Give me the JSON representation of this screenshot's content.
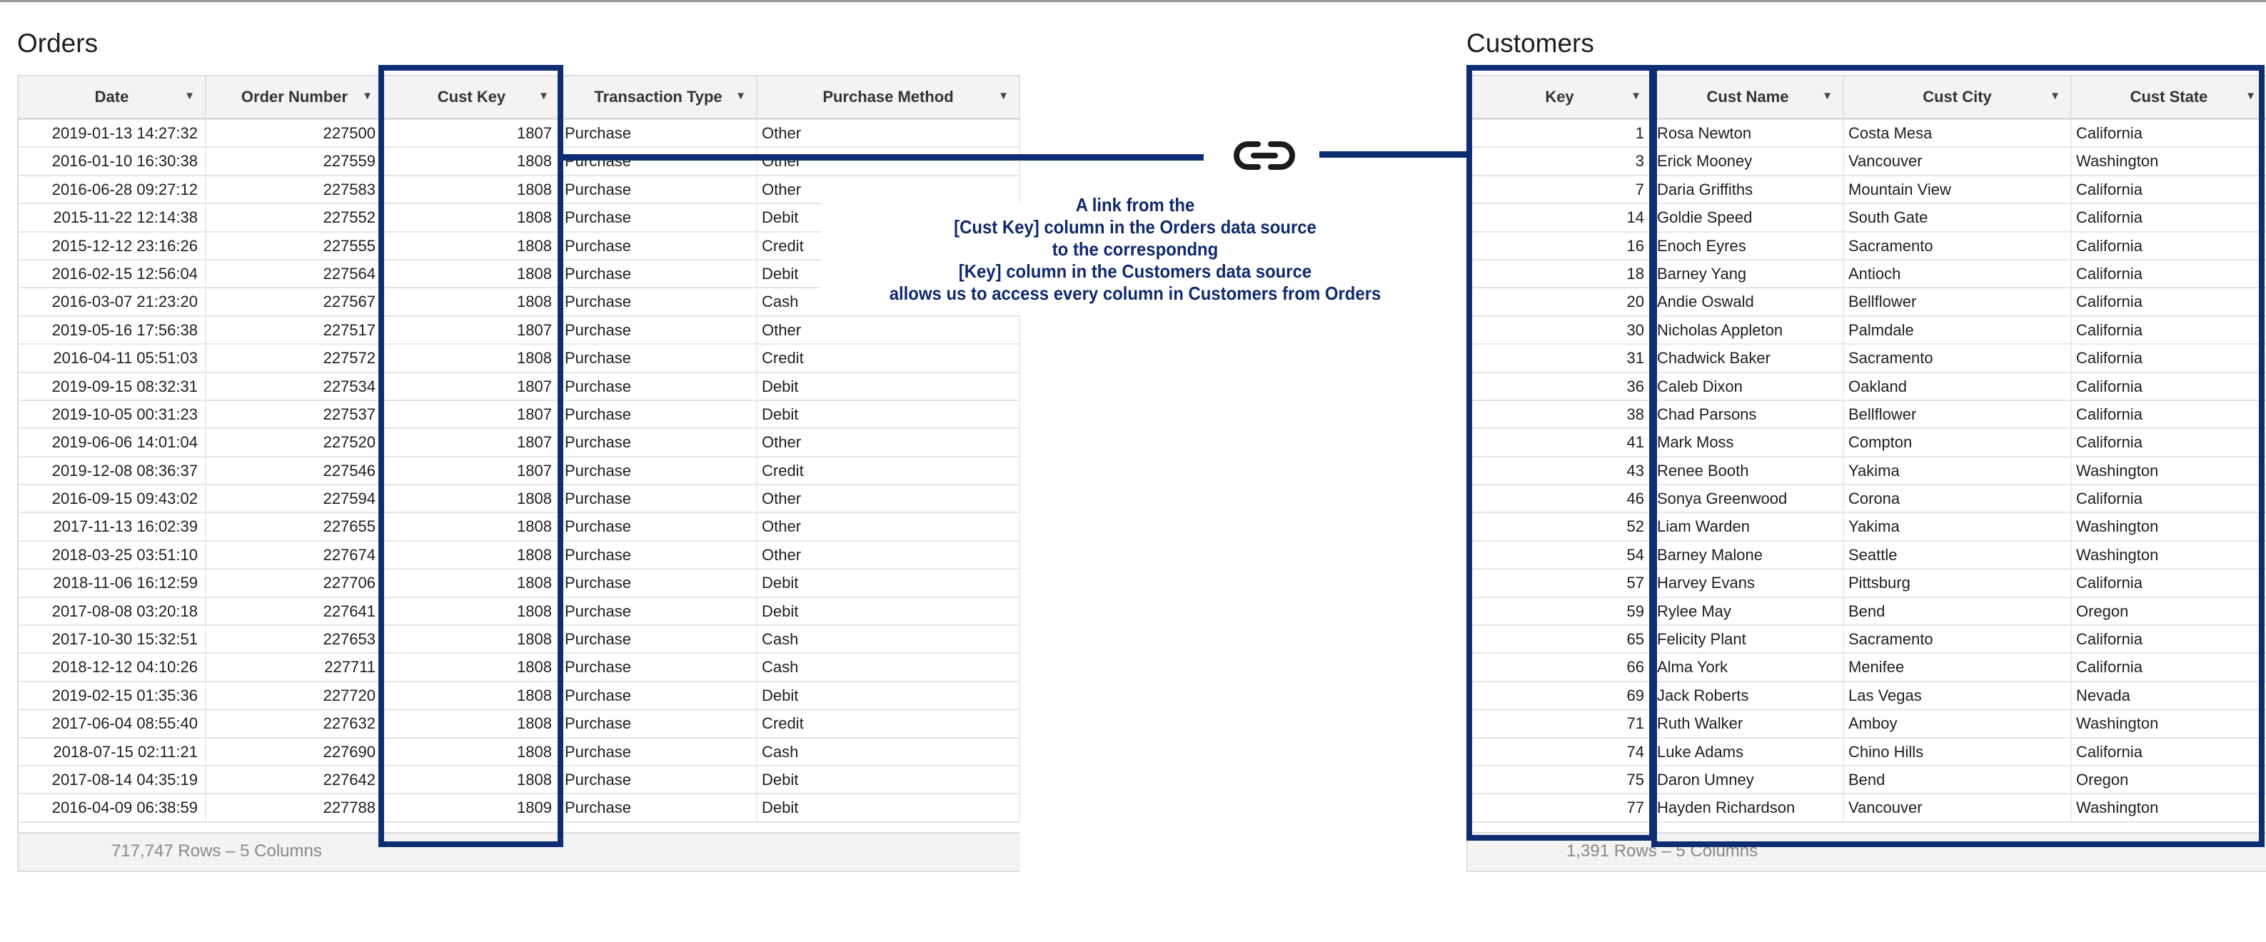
{
  "orders": {
    "title": "Orders",
    "columns": [
      "Date",
      "Order Number",
      "Cust Key",
      "Transaction Type",
      "Purchase Method"
    ],
    "rows": [
      [
        "2019-01-13 14:27:32",
        "227500",
        "1807",
        "Purchase",
        "Other"
      ],
      [
        "2016-01-10 16:30:38",
        "227559",
        "1808",
        "Purchase",
        "Other"
      ],
      [
        "2016-06-28 09:27:12",
        "227583",
        "1808",
        "Purchase",
        "Other"
      ],
      [
        "2015-11-22 12:14:38",
        "227552",
        "1808",
        "Purchase",
        "Debit"
      ],
      [
        "2015-12-12 23:16:26",
        "227555",
        "1808",
        "Purchase",
        "Credit"
      ],
      [
        "2016-02-15 12:56:04",
        "227564",
        "1808",
        "Purchase",
        "Debit"
      ],
      [
        "2016-03-07 21:23:20",
        "227567",
        "1808",
        "Purchase",
        "Cash"
      ],
      [
        "2019-05-16 17:56:38",
        "227517",
        "1807",
        "Purchase",
        "Other"
      ],
      [
        "2016-04-11 05:51:03",
        "227572",
        "1808",
        "Purchase",
        "Credit"
      ],
      [
        "2019-09-15 08:32:31",
        "227534",
        "1807",
        "Purchase",
        "Debit"
      ],
      [
        "2019-10-05 00:31:23",
        "227537",
        "1807",
        "Purchase",
        "Debit"
      ],
      [
        "2019-06-06 14:01:04",
        "227520",
        "1807",
        "Purchase",
        "Other"
      ],
      [
        "2019-12-08 08:36:37",
        "227546",
        "1807",
        "Purchase",
        "Credit"
      ],
      [
        "2016-09-15 09:43:02",
        "227594",
        "1808",
        "Purchase",
        "Other"
      ],
      [
        "2017-11-13 16:02:39",
        "227655",
        "1808",
        "Purchase",
        "Other"
      ],
      [
        "2018-03-25 03:51:10",
        "227674",
        "1808",
        "Purchase",
        "Other"
      ],
      [
        "2018-11-06 16:12:59",
        "227706",
        "1808",
        "Purchase",
        "Debit"
      ],
      [
        "2017-08-08 03:20:18",
        "227641",
        "1808",
        "Purchase",
        "Debit"
      ],
      [
        "2017-10-30 15:32:51",
        "227653",
        "1808",
        "Purchase",
        "Cash"
      ],
      [
        "2018-12-12 04:10:26",
        "227711",
        "1808",
        "Purchase",
        "Cash"
      ],
      [
        "2019-02-15 01:35:36",
        "227720",
        "1808",
        "Purchase",
        "Debit"
      ],
      [
        "2017-06-04 08:55:40",
        "227632",
        "1808",
        "Purchase",
        "Credit"
      ],
      [
        "2018-07-15 02:11:21",
        "227690",
        "1808",
        "Purchase",
        "Cash"
      ],
      [
        "2017-08-14 04:35:19",
        "227642",
        "1808",
        "Purchase",
        "Debit"
      ],
      [
        "2016-04-09 06:38:59",
        "227788",
        "1809",
        "Purchase",
        "Debit"
      ]
    ],
    "footer": "717,747 Rows – 5 Columns"
  },
  "customers": {
    "title": "Customers",
    "columns": [
      "Key",
      "Cust Name",
      "Cust City",
      "Cust State"
    ],
    "rows": [
      [
        "1",
        "Rosa Newton",
        "Costa Mesa",
        "California"
      ],
      [
        "3",
        "Erick Mooney",
        "Vancouver",
        "Washington"
      ],
      [
        "7",
        "Daria Griffiths",
        "Mountain View",
        "California"
      ],
      [
        "14",
        "Goldie Speed",
        "South Gate",
        "California"
      ],
      [
        "16",
        "Enoch Eyres",
        "Sacramento",
        "California"
      ],
      [
        "18",
        "Barney Yang",
        "Antioch",
        "California"
      ],
      [
        "20",
        "Andie Oswald",
        "Bellflower",
        "California"
      ],
      [
        "30",
        "Nicholas Appleton",
        "Palmdale",
        "California"
      ],
      [
        "31",
        "Chadwick Baker",
        "Sacramento",
        "California"
      ],
      [
        "36",
        "Caleb Dixon",
        "Oakland",
        "California"
      ],
      [
        "38",
        "Chad Parsons",
        "Bellflower",
        "California"
      ],
      [
        "41",
        "Mark Moss",
        "Compton",
        "California"
      ],
      [
        "43",
        "Renee Booth",
        "Yakima",
        "Washington"
      ],
      [
        "46",
        "Sonya Greenwood",
        "Corona",
        "California"
      ],
      [
        "52",
        "Liam Warden",
        "Yakima",
        "Washington"
      ],
      [
        "54",
        "Barney Malone",
        "Seattle",
        "Washington"
      ],
      [
        "57",
        "Harvey Evans",
        "Pittsburg",
        "California"
      ],
      [
        "59",
        "Rylee May",
        "Bend",
        "Oregon"
      ],
      [
        "65",
        "Felicity Plant",
        "Sacramento",
        "California"
      ],
      [
        "66",
        "Alma York",
        "Menifee",
        "California"
      ],
      [
        "69",
        "Jack Roberts",
        "Las Vegas",
        "Nevada"
      ],
      [
        "71",
        "Ruth Walker",
        "Amboy",
        "Washington"
      ],
      [
        "74",
        "Luke Adams",
        "Chino Hills",
        "California"
      ],
      [
        "75",
        "Daron Umney",
        "Bend",
        "Oregon"
      ],
      [
        "77",
        "Hayden Richardson",
        "Vancouver",
        "Washington"
      ]
    ],
    "footer": "1,391 Rows – 5 Columns"
  },
  "annotation": {
    "lines": [
      "A link from the",
      "[Cust Key] column in the Orders data source",
      "to the correspondng",
      "[Key] column in the Customers data source",
      "allows us to access every column in Customers from Orders"
    ],
    "icon": "link-icon"
  },
  "colors": {
    "highlight": "#0e2d73",
    "annotation_text": "#10296e"
  }
}
